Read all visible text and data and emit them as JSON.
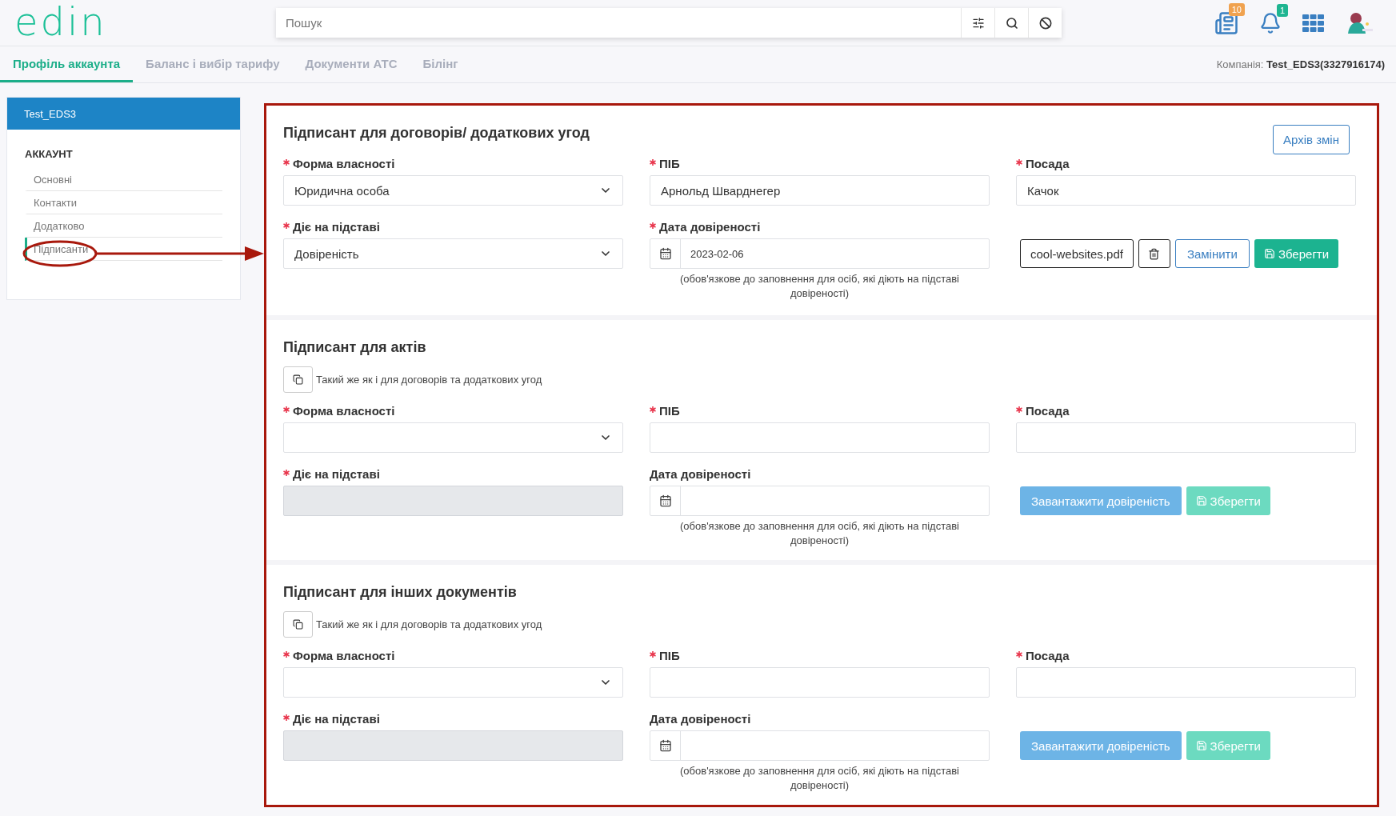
{
  "logo": "edin",
  "search": {
    "placeholder": "Пошук"
  },
  "header_icons": [
    {
      "kind": "news",
      "badge": "10",
      "color": "#f0a24f"
    },
    {
      "kind": "bell",
      "badge": "1",
      "color": "#1fb591"
    },
    {
      "kind": "apps"
    },
    {
      "kind": "avatar"
    }
  ],
  "tabs": [
    {
      "label": "Профіль аккаунта",
      "selected": true
    },
    {
      "label": "Баланс і вибір тарифу",
      "selected": false
    },
    {
      "label": "Документи АТС",
      "selected": false
    },
    {
      "label": "Білінг",
      "selected": false
    }
  ],
  "company": {
    "label": "Компанія:",
    "value": "Test_EDS3(3327916174)"
  },
  "sidebar": {
    "title": "Test_EDS3",
    "section": "АККАУНТ",
    "items": [
      {
        "label": "Основні",
        "selected": false
      },
      {
        "label": "Контакти",
        "selected": false
      },
      {
        "label": "Додатково",
        "selected": false
      },
      {
        "label": "Підписанти",
        "selected": true
      }
    ]
  },
  "sections": [
    {
      "title": "Підписант для договорів/ додаткових угод",
      "archive_button": "Архів змін",
      "fields": [
        {
          "kind": "select",
          "label": "Форма власності",
          "required": true,
          "value": "Юридична особа",
          "disabled": false
        },
        {
          "kind": "text",
          "label": "ПІБ",
          "required": true,
          "value": "Арнольд Шварднегер",
          "disabled": false
        },
        {
          "kind": "text",
          "label": "Посада",
          "required": true,
          "value": "Качок",
          "disabled": false
        },
        {
          "kind": "select",
          "label": "Діє на підставі",
          "required": true,
          "value": "Довіреність",
          "disabled": false
        },
        {
          "kind": "date",
          "label": "Дата довіреності",
          "required": true,
          "value": "2023-02-06",
          "hint": "(обов'язкове до заповнення для осіб, які діють на підставі довіреності)"
        }
      ],
      "actions": [
        {
          "kind": "file",
          "label": "cool-websites.pdf"
        },
        {
          "kind": "delete"
        },
        {
          "kind": "outline",
          "label": "Замінити"
        },
        {
          "kind": "save",
          "label": "Зберегти",
          "disabled": false
        }
      ]
    },
    {
      "title": "Підписант для актів",
      "copy_option": "Такий же як і для договорів та додаткових угод",
      "fields": [
        {
          "kind": "select",
          "label": "Форма власності",
          "required": true,
          "disabled": false
        },
        {
          "kind": "text",
          "label": "ПІБ",
          "required": true,
          "disabled": false
        },
        {
          "kind": "text",
          "label": "Посада",
          "required": true,
          "disabled": false
        },
        {
          "kind": "text",
          "label": "Діє на підставі",
          "required": true,
          "disabled": true
        },
        {
          "kind": "date",
          "label": "Дата довіреності",
          "required": false,
          "hint": "(обов'язкове до заповнення для осіб, які діють на підставі довіреності)"
        }
      ],
      "actions": [
        {
          "kind": "upload",
          "label": "Завантажити довіреність",
          "disabled": true
        },
        {
          "kind": "save",
          "label": "Зберегти",
          "disabled": true
        }
      ]
    },
    {
      "title": "Підписант для інших документів",
      "copy_option": "Такий же як і для договорів та додаткових угод",
      "fields": [
        {
          "kind": "select",
          "label": "Форма власності",
          "required": true,
          "disabled": false
        },
        {
          "kind": "text",
          "label": "ПІБ",
          "required": true,
          "disabled": false
        },
        {
          "kind": "text",
          "label": "Посада",
          "required": true,
          "disabled": false
        },
        {
          "kind": "text",
          "label": "Діє на підставі",
          "required": true,
          "disabled": true
        },
        {
          "kind": "date",
          "label": "Дата довіреності",
          "required": false,
          "hint": "(обов'язкове до заповнення для осіб, які діють на підставі довіреності)"
        }
      ],
      "actions": [
        {
          "kind": "upload",
          "label": "Завантажити довіреність",
          "disabled": true
        },
        {
          "kind": "save",
          "label": "Зберегти",
          "disabled": true
        }
      ]
    }
  ]
}
